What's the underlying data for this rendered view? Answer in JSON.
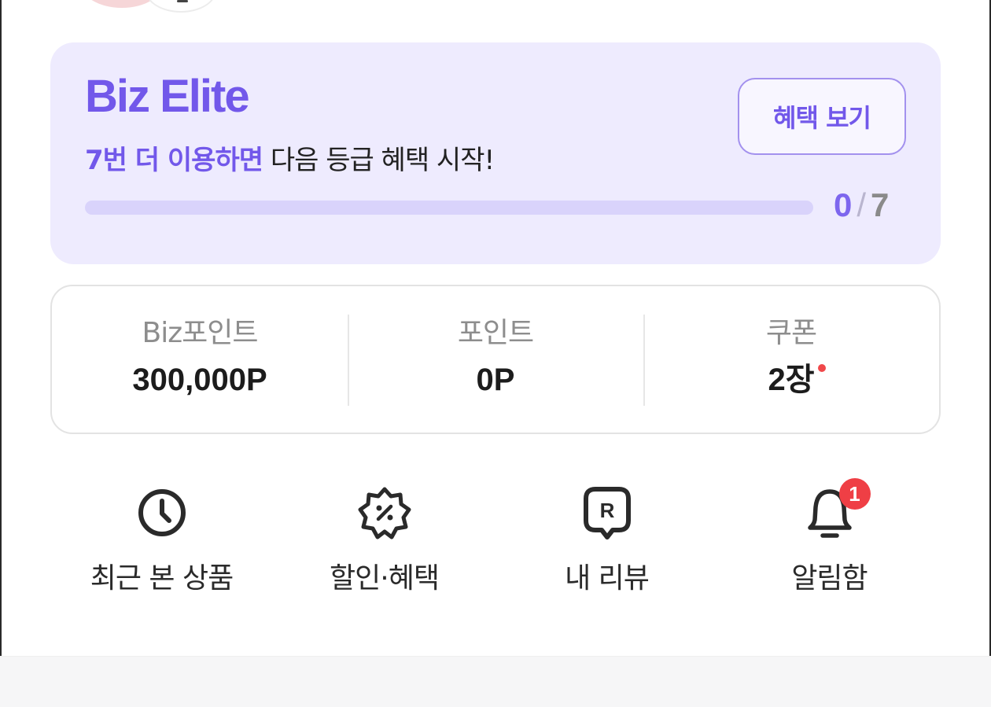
{
  "profile": {
    "avatar_icon": "avatar-image",
    "badge_icon": "edit-badge-icon"
  },
  "grade": {
    "name": "Biz Elite",
    "message_highlight": "7번 더 이용하면",
    "message_rest": " 다음 등급 혜택 시작!",
    "benefit_button": "혜택 보기",
    "progress_current": "0",
    "progress_separator": "/",
    "progress_total": "7",
    "progress_fraction": 0,
    "accent_color": "#7258ea",
    "card_color": "#eeebfe"
  },
  "stats": [
    {
      "label": "Biz포인트",
      "value": "300,000P",
      "has_new_dot": false
    },
    {
      "label": "포인트",
      "value": "0P",
      "has_new_dot": false
    },
    {
      "label": "쿠폰",
      "value": "2장",
      "has_new_dot": true
    }
  ],
  "menu": [
    {
      "label": "최근 본 상품",
      "icon": "clock-icon"
    },
    {
      "label": "할인·혜택",
      "icon": "discount-badge-icon"
    },
    {
      "label": "내 리뷰",
      "icon": "review-icon"
    },
    {
      "label": "알림함",
      "icon": "bell-icon",
      "badge": "1"
    }
  ],
  "colors": {
    "notification_badge": "#ef3f45",
    "new_dot": "#f0484a"
  }
}
